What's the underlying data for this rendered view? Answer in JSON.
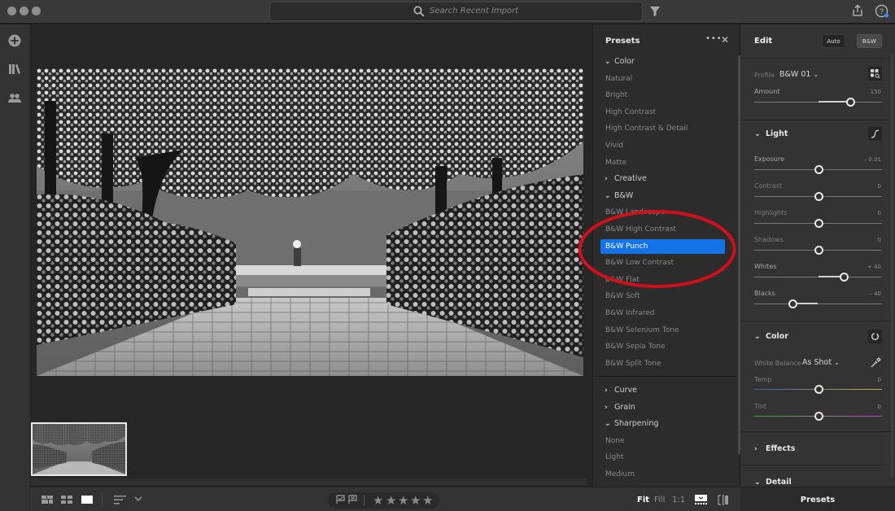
{
  "titlebar": {
    "search_placeholder": "Search Recent Import",
    "icons": [
      "search-icon",
      "filter-icon",
      "share-icon",
      "help-icon"
    ]
  },
  "left_rail": {
    "icons": [
      "add-photos-icon",
      "library-icon",
      "people-icon"
    ]
  },
  "filmstrip": {
    "thumbnails": [
      {
        "selected": true
      }
    ]
  },
  "bottombar": {
    "view_icons": [
      "square-grid-icon",
      "grid-icon",
      "single-view-icon",
      "sort-icon",
      "chevron-down-icon"
    ],
    "flags": [
      "pick-flag-icon",
      "reject-flag-icon"
    ],
    "rating": {
      "stars_total": 5,
      "stars_filled": 0,
      "star_glyph": "★"
    },
    "zoom_options": [
      {
        "label": "Fit",
        "active": true
      },
      {
        "label": "Fill",
        "active": false
      },
      {
        "label": "1:1",
        "active": false
      }
    ]
  },
  "presets_panel": {
    "title": "Presets",
    "more_glyph": "•••",
    "close_glyph": "✕",
    "rows": [
      {
        "type": "group",
        "label": "Color",
        "expanded": true
      },
      {
        "type": "item",
        "label": "Natural"
      },
      {
        "type": "item",
        "label": "Bright"
      },
      {
        "type": "item",
        "label": "High Contrast"
      },
      {
        "type": "item",
        "label": "High Contrast & Detail"
      },
      {
        "type": "item",
        "label": "Vivid"
      },
      {
        "type": "item",
        "label": "Matte"
      },
      {
        "type": "group",
        "label": "Creative",
        "expanded": false
      },
      {
        "type": "group",
        "label": "B&W",
        "expanded": true
      },
      {
        "type": "item",
        "label": "B&W Landscape"
      },
      {
        "type": "item",
        "label": "B&W High Contrast"
      },
      {
        "type": "item",
        "label": "B&W Punch",
        "selected": true
      },
      {
        "type": "item",
        "label": "B&W Low Contrast"
      },
      {
        "type": "item",
        "label": "B&W Flat"
      },
      {
        "type": "item",
        "label": "B&W Soft"
      },
      {
        "type": "item",
        "label": "B&W Infrared"
      },
      {
        "type": "item",
        "label": "B&W Selenium Tone"
      },
      {
        "type": "item",
        "label": "B&W Sepia Tone"
      },
      {
        "type": "item",
        "label": "B&W Split Tone"
      },
      {
        "type": "group",
        "label": "Curve",
        "expanded": false
      },
      {
        "type": "group",
        "label": "Grain",
        "expanded": false
      },
      {
        "type": "group",
        "label": "Sharpening",
        "expanded": true
      },
      {
        "type": "item",
        "label": "None"
      },
      {
        "type": "item",
        "label": "Light"
      },
      {
        "type": "item",
        "label": "Medium"
      }
    ],
    "chevron_expanded": "⌄",
    "chevron_collapsed": "›",
    "selected_color": "#1473e6",
    "annotation_color": "#d0101a"
  },
  "edit_panel": {
    "title": "Edit",
    "auto_label": "Auto",
    "bw_label": "B&W",
    "profile": {
      "label": "Profile",
      "value": "B&W 01",
      "chevron": "⌄"
    },
    "amount": {
      "label": "Amount",
      "value": "150",
      "fraction": 0.75
    },
    "light": {
      "title": "Light",
      "sliders": [
        {
          "label": "Exposure",
          "value": "– 0.01",
          "fraction": 0.5
        },
        {
          "label": "Contrast",
          "value": "0",
          "fraction": 0.5
        },
        {
          "label": "Highlights",
          "value": "0",
          "fraction": 0.5
        },
        {
          "label": "Shadows",
          "value": "0",
          "fraction": 0.5
        },
        {
          "label": "Whites",
          "value": "+ 40",
          "fraction": 0.7
        },
        {
          "label": "Blacks",
          "value": "– 40",
          "fraction": 0.3
        }
      ]
    },
    "color": {
      "title": "Color",
      "white_balance_label": "White Balance",
      "white_balance_value": "As Shot",
      "sliders": [
        {
          "label": "Temp",
          "value": "0",
          "fraction": 0.5
        },
        {
          "label": "Tint",
          "value": "0",
          "fraction": 0.5
        }
      ]
    },
    "effects": {
      "title": "Effects"
    },
    "detail": {
      "title": "Detail"
    },
    "presets_tab_label": "Presets"
  }
}
